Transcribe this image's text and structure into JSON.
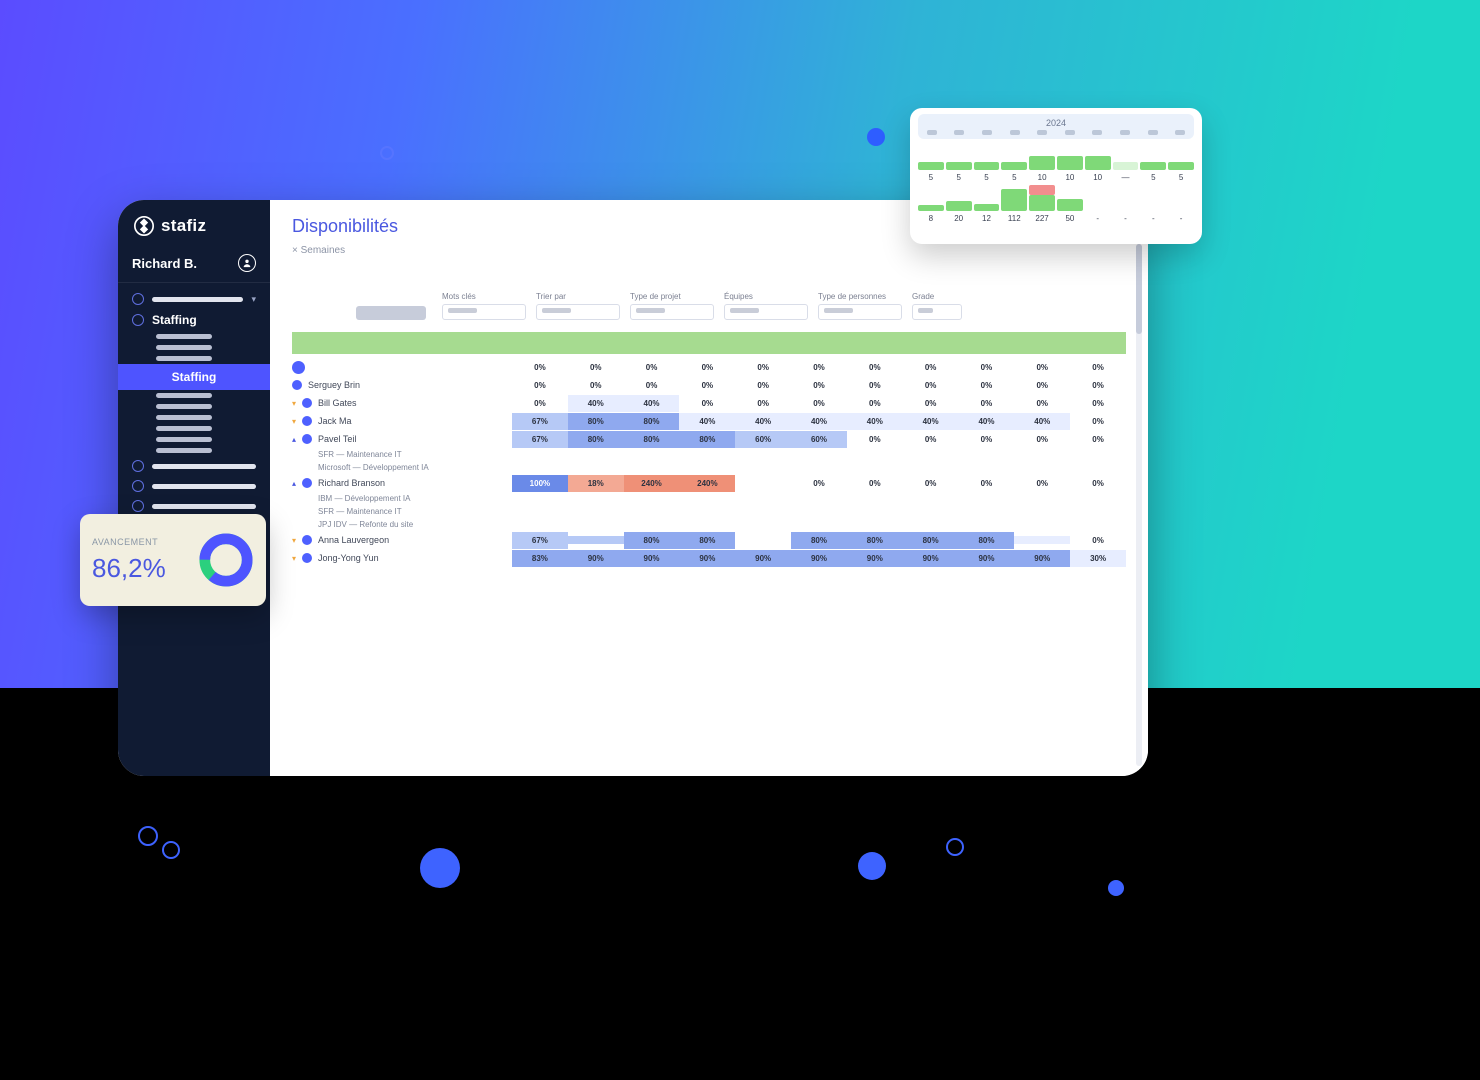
{
  "brand": {
    "name": "stafiz"
  },
  "user": {
    "name": "Richard B."
  },
  "sidebar": {
    "section_label": "Staffing",
    "active_sub_label": "Staffing"
  },
  "page": {
    "title": "Disponibilités",
    "tag": "Semaines"
  },
  "filters": {
    "keywords": "Mots clés",
    "sort": "Trier par",
    "project_type": "Type de projet",
    "teams": "Équipes",
    "person_type": "Type de personnes",
    "grade": "Grade"
  },
  "rows": {
    "r0": {
      "name": "",
      "cells": [
        "0%",
        "0%",
        "0%",
        "0%",
        "0%",
        "0%",
        "0%",
        "0%",
        "0%",
        "0%",
        "0%"
      ]
    },
    "r1": {
      "name": "Serguey Brin",
      "cells": [
        "0%",
        "0%",
        "0%",
        "0%",
        "0%",
        "0%",
        "0%",
        "0%",
        "0%",
        "0%",
        "0%"
      ]
    },
    "r2": {
      "name": "Bill Gates",
      "cells": [
        "0%",
        "40%",
        "40%",
        "0%",
        "0%",
        "0%",
        "0%",
        "0%",
        "0%",
        "0%",
        "0%"
      ]
    },
    "r3": {
      "name": "Jack Ma",
      "cells": [
        "67%",
        "80%",
        "80%",
        "40%",
        "40%",
        "40%",
        "40%",
        "40%",
        "40%",
        "40%",
        "0%"
      ]
    },
    "r4": {
      "name": "Pavel Teil",
      "cells": [
        "67%",
        "80%",
        "80%",
        "80%",
        "60%",
        "60%",
        "0%",
        "0%",
        "0%",
        "0%",
        "0%"
      ]
    },
    "r4a": {
      "label": "SFR — Maintenance IT"
    },
    "r4b": {
      "label": "Microsoft — Développement IA"
    },
    "r5": {
      "name": "Richard Branson",
      "cells": [
        "100%",
        "18%",
        "240%",
        "240%",
        "",
        "0%",
        "0%",
        "0%",
        "0%",
        "0%",
        "0%"
      ]
    },
    "r5a": {
      "label": "IBM — Développement IA"
    },
    "r5b": {
      "label": "SFR — Maintenance IT"
    },
    "r5c": {
      "label": "JPJ IDV — Refonte du site"
    },
    "r6": {
      "name": "Anna Lauvergeon",
      "cells": [
        "67%",
        "",
        "80%",
        "80%",
        "",
        "80%",
        "80%",
        "80%",
        "80%",
        "",
        "0%"
      ]
    },
    "r7": {
      "name": "Jong-Yong Yun",
      "cells": [
        "83%",
        "90%",
        "90%",
        "90%",
        "90%",
        "90%",
        "90%",
        "90%",
        "90%",
        "90%",
        "30%"
      ]
    }
  },
  "advance": {
    "label": "AVANCEMENT",
    "value": "86,2%"
  },
  "year_card": {
    "year": "2024",
    "row2": [
      "5",
      "5",
      "5",
      "5",
      "10",
      "10",
      "10",
      "—",
      "5",
      "5"
    ],
    "row4": [
      "8",
      "20",
      "12",
      "112",
      "227",
      "50",
      "-",
      "-",
      "-",
      "-"
    ]
  }
}
